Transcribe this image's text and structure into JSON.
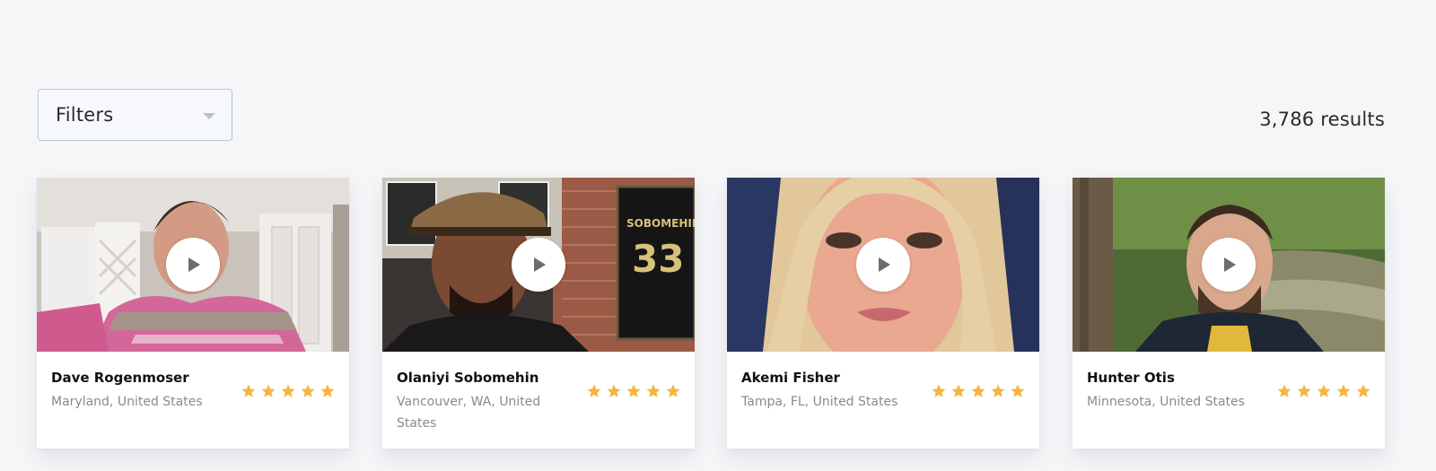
{
  "toolbar": {
    "filters_label": "Filters",
    "results_text": "3,786 results"
  },
  "colors": {
    "background": "#f5f6f8",
    "star": "#f5b53f",
    "filter_border": "#b9c6d9",
    "location_text": "#858b93"
  },
  "cards": [
    {
      "name": "Dave Rogenmoser",
      "location": "Maryland, United States",
      "rating": 5,
      "thumbnail": "man-in-kitchen-video"
    },
    {
      "name": "Olaniyi Sobomehin",
      "location": "Vancouver, WA, United States",
      "rating": 5,
      "thumbnail": "man-in-cap-brick-wall-video"
    },
    {
      "name": "Akemi Fisher",
      "location": "Tampa, FL, United States",
      "rating": 5,
      "thumbnail": "woman-closeup-video"
    },
    {
      "name": "Hunter Otis",
      "location": "Minnesota, United States",
      "rating": 5,
      "thumbnail": "man-by-creek-video"
    }
  ],
  "icons": {
    "filter_caret": "chevron-down-icon",
    "play": "play-icon",
    "star": "star-icon"
  }
}
